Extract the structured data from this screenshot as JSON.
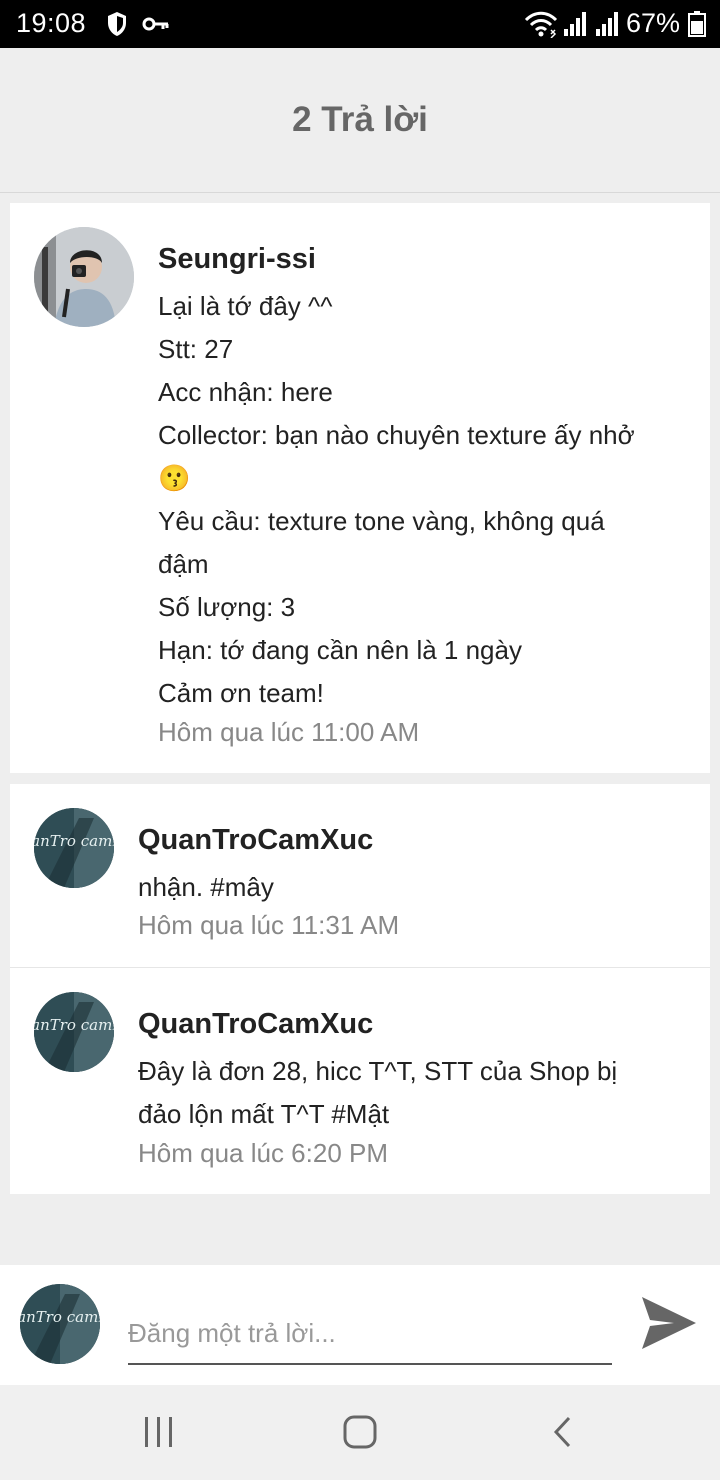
{
  "status_bar": {
    "time": "19:08",
    "battery_percent": "67%",
    "icons": [
      "shield-icon",
      "key-icon",
      "wifi-icon",
      "signal-icon",
      "signal-icon",
      "battery-icon"
    ]
  },
  "header": {
    "title": "2 Trả lời"
  },
  "main_post": {
    "author": "Seungri-ssi",
    "lines": [
      "Lại là tớ đây ^^",
      "Stt: 27",
      "Acc nhận: here",
      "Collector: bạn nào chuyên texture ấy nhở",
      "😗",
      "Yêu cầu: texture tone vàng, không quá",
      "đậm",
      "Số lượng: 3",
      "Hạn: tớ đang cần nên là 1 ngày",
      "Cảm ơn team!"
    ],
    "time": "Hôm qua lúc 11:00 AM"
  },
  "replies": [
    {
      "author": "QuanTroCamXuc",
      "lines": [
        "nhận. #mây"
      ],
      "time": "Hôm qua lúc 11:31 AM"
    },
    {
      "author": "QuanTroCamXuc",
      "lines": [
        "Đây là đơn 28, hicc T^T, STT của Shop bị",
        "đảo lộn mất T^T #Mật"
      ],
      "time": "Hôm qua lúc 6:20 PM"
    }
  ],
  "avatar_logo_text": "QuanTro camxuc",
  "composer": {
    "placeholder": "Đăng một trả lời..."
  },
  "colors": {
    "accent_send": "#666666",
    "header_text": "#666666",
    "timestamp": "#888888"
  }
}
